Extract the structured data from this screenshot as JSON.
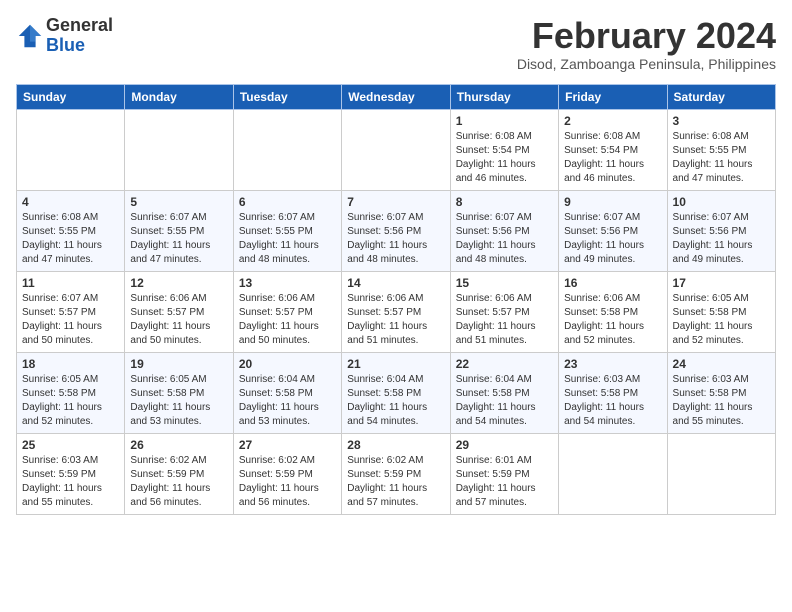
{
  "logo": {
    "general": "General",
    "blue": "Blue"
  },
  "title": {
    "month_year": "February 2024",
    "location": "Disod, Zamboanga Peninsula, Philippines"
  },
  "headers": [
    "Sunday",
    "Monday",
    "Tuesday",
    "Wednesday",
    "Thursday",
    "Friday",
    "Saturday"
  ],
  "weeks": [
    [
      {
        "day": "",
        "info": ""
      },
      {
        "day": "",
        "info": ""
      },
      {
        "day": "",
        "info": ""
      },
      {
        "day": "",
        "info": ""
      },
      {
        "day": "1",
        "info": "Sunrise: 6:08 AM\nSunset: 5:54 PM\nDaylight: 11 hours and 46 minutes."
      },
      {
        "day": "2",
        "info": "Sunrise: 6:08 AM\nSunset: 5:54 PM\nDaylight: 11 hours and 46 minutes."
      },
      {
        "day": "3",
        "info": "Sunrise: 6:08 AM\nSunset: 5:55 PM\nDaylight: 11 hours and 47 minutes."
      }
    ],
    [
      {
        "day": "4",
        "info": "Sunrise: 6:08 AM\nSunset: 5:55 PM\nDaylight: 11 hours and 47 minutes."
      },
      {
        "day": "5",
        "info": "Sunrise: 6:07 AM\nSunset: 5:55 PM\nDaylight: 11 hours and 47 minutes."
      },
      {
        "day": "6",
        "info": "Sunrise: 6:07 AM\nSunset: 5:55 PM\nDaylight: 11 hours and 48 minutes."
      },
      {
        "day": "7",
        "info": "Sunrise: 6:07 AM\nSunset: 5:56 PM\nDaylight: 11 hours and 48 minutes."
      },
      {
        "day": "8",
        "info": "Sunrise: 6:07 AM\nSunset: 5:56 PM\nDaylight: 11 hours and 48 minutes."
      },
      {
        "day": "9",
        "info": "Sunrise: 6:07 AM\nSunset: 5:56 PM\nDaylight: 11 hours and 49 minutes."
      },
      {
        "day": "10",
        "info": "Sunrise: 6:07 AM\nSunset: 5:56 PM\nDaylight: 11 hours and 49 minutes."
      }
    ],
    [
      {
        "day": "11",
        "info": "Sunrise: 6:07 AM\nSunset: 5:57 PM\nDaylight: 11 hours and 50 minutes."
      },
      {
        "day": "12",
        "info": "Sunrise: 6:06 AM\nSunset: 5:57 PM\nDaylight: 11 hours and 50 minutes."
      },
      {
        "day": "13",
        "info": "Sunrise: 6:06 AM\nSunset: 5:57 PM\nDaylight: 11 hours and 50 minutes."
      },
      {
        "day": "14",
        "info": "Sunrise: 6:06 AM\nSunset: 5:57 PM\nDaylight: 11 hours and 51 minutes."
      },
      {
        "day": "15",
        "info": "Sunrise: 6:06 AM\nSunset: 5:57 PM\nDaylight: 11 hours and 51 minutes."
      },
      {
        "day": "16",
        "info": "Sunrise: 6:06 AM\nSunset: 5:58 PM\nDaylight: 11 hours and 52 minutes."
      },
      {
        "day": "17",
        "info": "Sunrise: 6:05 AM\nSunset: 5:58 PM\nDaylight: 11 hours and 52 minutes."
      }
    ],
    [
      {
        "day": "18",
        "info": "Sunrise: 6:05 AM\nSunset: 5:58 PM\nDaylight: 11 hours and 52 minutes."
      },
      {
        "day": "19",
        "info": "Sunrise: 6:05 AM\nSunset: 5:58 PM\nDaylight: 11 hours and 53 minutes."
      },
      {
        "day": "20",
        "info": "Sunrise: 6:04 AM\nSunset: 5:58 PM\nDaylight: 11 hours and 53 minutes."
      },
      {
        "day": "21",
        "info": "Sunrise: 6:04 AM\nSunset: 5:58 PM\nDaylight: 11 hours and 54 minutes."
      },
      {
        "day": "22",
        "info": "Sunrise: 6:04 AM\nSunset: 5:58 PM\nDaylight: 11 hours and 54 minutes."
      },
      {
        "day": "23",
        "info": "Sunrise: 6:03 AM\nSunset: 5:58 PM\nDaylight: 11 hours and 54 minutes."
      },
      {
        "day": "24",
        "info": "Sunrise: 6:03 AM\nSunset: 5:58 PM\nDaylight: 11 hours and 55 minutes."
      }
    ],
    [
      {
        "day": "25",
        "info": "Sunrise: 6:03 AM\nSunset: 5:59 PM\nDaylight: 11 hours and 55 minutes."
      },
      {
        "day": "26",
        "info": "Sunrise: 6:02 AM\nSunset: 5:59 PM\nDaylight: 11 hours and 56 minutes."
      },
      {
        "day": "27",
        "info": "Sunrise: 6:02 AM\nSunset: 5:59 PM\nDaylight: 11 hours and 56 minutes."
      },
      {
        "day": "28",
        "info": "Sunrise: 6:02 AM\nSunset: 5:59 PM\nDaylight: 11 hours and 57 minutes."
      },
      {
        "day": "29",
        "info": "Sunrise: 6:01 AM\nSunset: 5:59 PM\nDaylight: 11 hours and 57 minutes."
      },
      {
        "day": "",
        "info": ""
      },
      {
        "day": "",
        "info": ""
      }
    ]
  ]
}
